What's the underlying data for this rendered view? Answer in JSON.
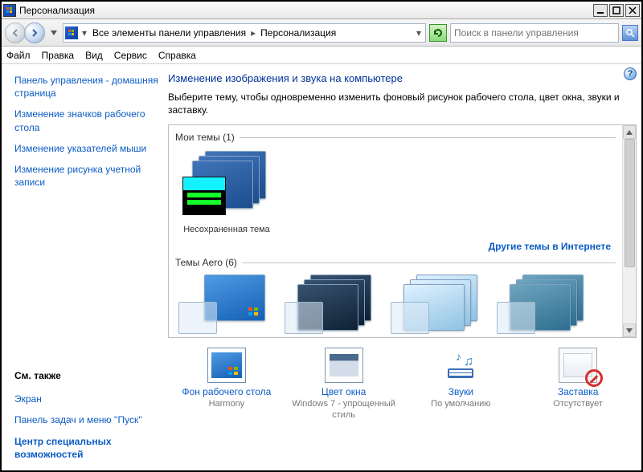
{
  "window": {
    "title": "Персонализация"
  },
  "breadcrumb": {
    "item1": "Все элементы панели управления",
    "item2": "Персонализация"
  },
  "search": {
    "placeholder": "Поиск в панели управления"
  },
  "menu": {
    "file": "Файл",
    "edit": "Правка",
    "view": "Вид",
    "tools": "Сервис",
    "help": "Справка"
  },
  "sidebar": {
    "home": "Панель управления - домашняя страница",
    "desktop_icons": "Изменение значков рабочего стола",
    "pointers": "Изменение указателей мыши",
    "account_pic": "Изменение рисунка учетной записи",
    "see_also": "См. также",
    "screen": "Экран",
    "taskbar": "Панель задач и меню ''Пуск''",
    "ease": "Центр специальных возможностей"
  },
  "main": {
    "heading": "Изменение изображения и звука на компьютере",
    "subtext": "Выберите тему, чтобы одновременно изменить фоновый рисунок рабочего стола, цвет окна, звуки и заставку."
  },
  "themes": {
    "my_hdr": "Мои темы (1)",
    "unsaved": "Несохраненная тема",
    "more_link": "Другие темы в Интернете",
    "aero_hdr": "Темы Aero (6)"
  },
  "actions": {
    "bg_title": "Фон рабочего стола",
    "bg_sub": "Harmony",
    "color_title": "Цвет окна",
    "color_sub": "Windows 7 - упрощенный стиль",
    "sound_title": "Звуки",
    "sound_sub": "По умолчанию",
    "saver_title": "Заставка",
    "saver_sub": "Отсутствует"
  }
}
